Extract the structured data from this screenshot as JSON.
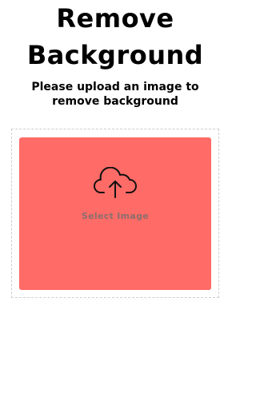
{
  "header": {
    "title": "Remove Background",
    "subtitle": "Please upload an image to remove background"
  },
  "upload": {
    "label": "Select Image",
    "icon": "cloud-upload-icon",
    "accent_color": "#ff6b66"
  }
}
